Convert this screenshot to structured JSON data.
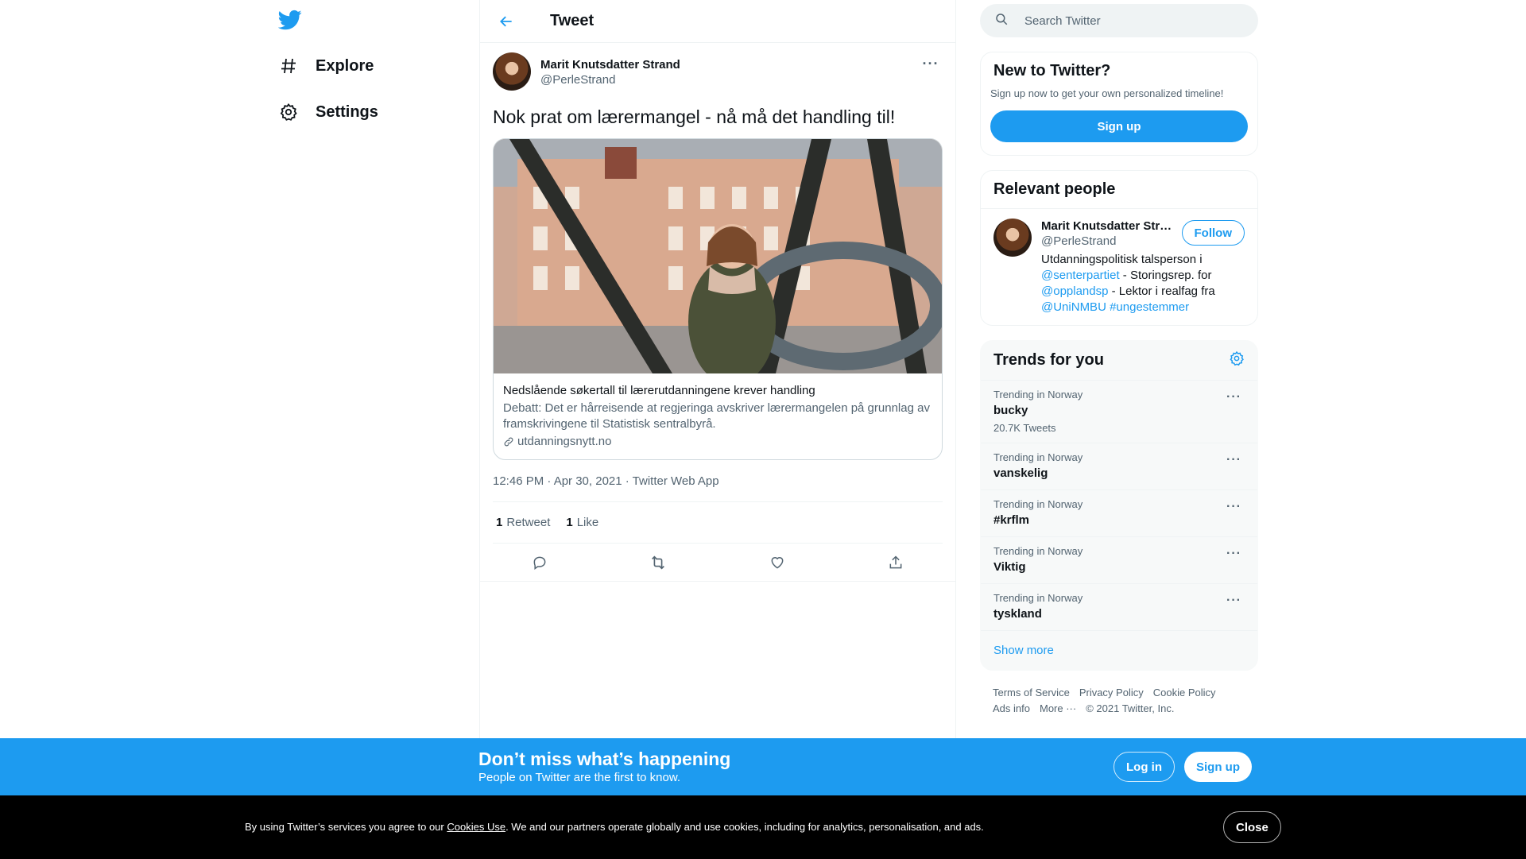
{
  "nav": {
    "explore_label": "Explore",
    "settings_label": "Settings"
  },
  "header": {
    "title": "Tweet"
  },
  "tweet": {
    "author_name": "Marit Knutsdatter Strand",
    "author_handle": "@PerleStrand",
    "text": "Nok prat om lærermangel - nå må det handling til!",
    "card": {
      "title": "Nedslående søkertall til lærerutdanningene krever handling",
      "description": "Debatt: Det er hårreisende at regjeringa avskriver lærermangelen på grunnlag av framskrivingene til Statistisk sentralbyrå.",
      "domain": "utdanningsnytt.no"
    },
    "timestamp": "12:46 PM · Apr 30, 2021 · Twitter Web App",
    "retweets_count": "1",
    "retweets_label": "Retweet",
    "likes_count": "1",
    "likes_label": "Like"
  },
  "search": {
    "placeholder": "Search Twitter"
  },
  "new_to_twitter": {
    "title": "New to Twitter?",
    "subtitle": "Sign up now to get your own personalized timeline!",
    "signup_label": "Sign up"
  },
  "relevant_people": {
    "title": "Relevant people",
    "name": "Marit Knutsdatter Str…",
    "handle": "@PerleStrand",
    "follow_label": "Follow",
    "bio_1": "Utdanningspolitisk talsperson i",
    "bio_link_1": "@senterpartiet",
    "bio_2": " - Storingsrep. for",
    "bio_link_2": "@opplandsp",
    "bio_3": " - Lektor i realfag fra",
    "bio_link_3": "@UniNMBU",
    "bio_link_4": "#ungestemmer"
  },
  "trends": {
    "title": "Trends for you",
    "items": [
      {
        "meta": "Trending in Norway",
        "name": "bucky",
        "count": "20.7K Tweets"
      },
      {
        "meta": "Trending in Norway",
        "name": "vanskelig"
      },
      {
        "meta": "Trending in Norway",
        "name": "#krflm"
      },
      {
        "meta": "Trending in Norway",
        "name": "Viktig"
      },
      {
        "meta": "Trending in Norway",
        "name": "tyskland"
      }
    ],
    "show_more": "Show more"
  },
  "footer": {
    "terms": "Terms of Service",
    "privacy": "Privacy Policy",
    "cookie": "Cookie Policy",
    "ads": "Ads info",
    "more": "More ···",
    "copyright": "© 2021 Twitter, Inc."
  },
  "banner": {
    "title": "Don’t miss what’s happening",
    "subtitle": "People on Twitter are the first to know.",
    "login_label": "Log in",
    "signup_label": "Sign up"
  },
  "cookie_bar": {
    "text_before": "By using Twitter’s services you agree to our ",
    "link": "Cookies Use",
    "text_after": ". We and our partners operate globally and use cookies, including for analytics, personalisation, and ads.",
    "close_label": "Close"
  },
  "colors": {
    "accent": "#1d9bf0",
    "banner": "#1d9bf0",
    "cookie_bg": "#000000"
  }
}
